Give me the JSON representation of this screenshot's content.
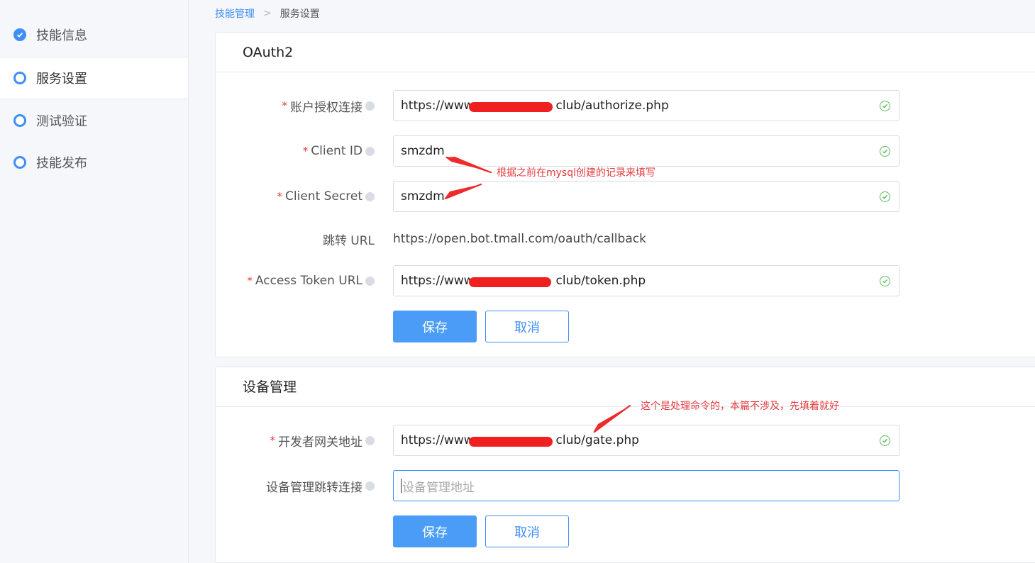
{
  "sidebar": {
    "items": [
      {
        "label": "技能信息",
        "state": "done"
      },
      {
        "label": "服务设置",
        "state": "active"
      },
      {
        "label": "测试验证",
        "state": "pending"
      },
      {
        "label": "技能发布",
        "state": "pending"
      }
    ]
  },
  "breadcrumb": {
    "parent": "技能管理",
    "separator": ">",
    "current": "服务设置"
  },
  "oauth": {
    "title": "OAuth2",
    "fields": {
      "authorize": {
        "label": "账户授权连接",
        "value_prefix": "https://www.",
        "value_suffix": "club/authorize.php"
      },
      "client_id": {
        "label": "Client ID",
        "value": "smzdm"
      },
      "client_secret": {
        "label": "Client Secret",
        "value": "smzdm"
      },
      "redirect": {
        "label": "跳转 URL",
        "value": "https://open.bot.tmall.com/oauth/callback"
      },
      "token": {
        "label": "Access Token URL",
        "value_prefix": "https://www.",
        "value_suffix": "club/token.php"
      }
    },
    "save_label": "保存",
    "cancel_label": "取消"
  },
  "device": {
    "title": "设备管理",
    "fields": {
      "gateway": {
        "label": "开发者网关地址",
        "value_prefix": "https://www.",
        "value_suffix": "club/gate.php"
      },
      "redirect_link": {
        "label": "设备管理跳转连接",
        "placeholder": "设备管理地址"
      }
    },
    "save_label": "保存",
    "cancel_label": "取消"
  },
  "annotations": {
    "client_note": "根据之前在mysql创建的记录来填写",
    "gateway_note": "这个是处理命令的，本篇不涉及，先填着就好"
  },
  "required_mark": "*",
  "colors": {
    "accent": "#3e8ef7",
    "required": "#e4393c",
    "valid": "#5cb85c",
    "annotation": "#e4393c"
  },
  "icons": {
    "done_step": "check-circle-icon",
    "pending_step": "ring-icon",
    "field_valid": "check-circle-icon",
    "field_help": "help-dot-icon"
  }
}
